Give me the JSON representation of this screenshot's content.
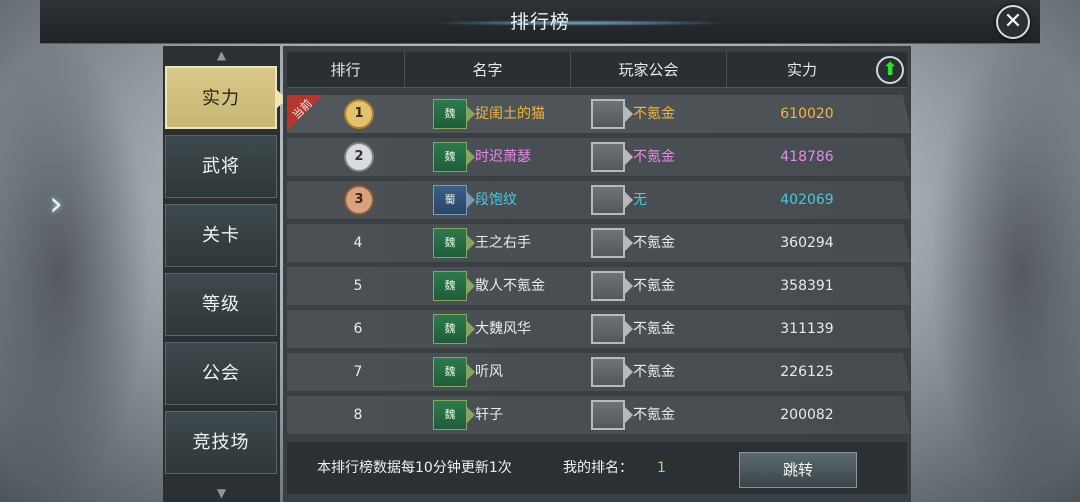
{
  "window": {
    "title": "排行榜"
  },
  "colors": {
    "gold": "#f2b63a",
    "purple": "#e58ae8",
    "cyan": "#4ac8e0",
    "green_value": "#9ee06a"
  },
  "sidebar": {
    "items": [
      {
        "label": "实力",
        "active": true
      },
      {
        "label": "武将",
        "active": false
      },
      {
        "label": "关卡",
        "active": false
      },
      {
        "label": "等级",
        "active": false
      },
      {
        "label": "公会",
        "active": false
      },
      {
        "label": "竞技场",
        "active": false
      }
    ]
  },
  "table": {
    "headers": [
      "排行",
      "名字",
      "玩家公会",
      "实力"
    ],
    "current_badge": "当前",
    "rows": [
      {
        "rank": "1",
        "medal": "gold",
        "faction": "魏",
        "name": "捉闺土的猫",
        "guild": "不氪金",
        "power": "610020",
        "color": "#f2b63a"
      },
      {
        "rank": "2",
        "medal": "silver",
        "faction": "魏",
        "name": "时迟萧瑟",
        "guild": "不氪金",
        "power": "418786",
        "color": "#e58ae8"
      },
      {
        "rank": "3",
        "medal": "bronze",
        "faction": "蜀",
        "name": "段饱纹",
        "guild": "无",
        "power": "402069",
        "color": "#4ac8e0"
      },
      {
        "rank": "4",
        "medal": "",
        "faction": "魏",
        "name": "王之右手",
        "guild": "不氪金",
        "power": "360294",
        "color": "#e8ecee"
      },
      {
        "rank": "5",
        "medal": "",
        "faction": "魏",
        "name": "散人不氪金",
        "guild": "不氪金",
        "power": "358391",
        "color": "#e8ecee"
      },
      {
        "rank": "6",
        "medal": "",
        "faction": "魏",
        "name": "大魏风华",
        "guild": "不氪金",
        "power": "311139",
        "color": "#e8ecee"
      },
      {
        "rank": "7",
        "medal": "",
        "faction": "魏",
        "name": "听风",
        "guild": "不氪金",
        "power": "226125",
        "color": "#e8ecee"
      },
      {
        "rank": "8",
        "medal": "",
        "faction": "魏",
        "name": "轩子",
        "guild": "不氪金",
        "power": "200082",
        "color": "#e8ecee"
      }
    ]
  },
  "footer": {
    "update_note": "本排行榜数据每10分钟更新1次",
    "my_rank_label": "我的排名：",
    "my_rank_value": "1",
    "jump_label": "跳转"
  },
  "icons": {
    "close": "close-icon",
    "up": "up-arrow-icon",
    "left": "chevron-left-icon"
  }
}
